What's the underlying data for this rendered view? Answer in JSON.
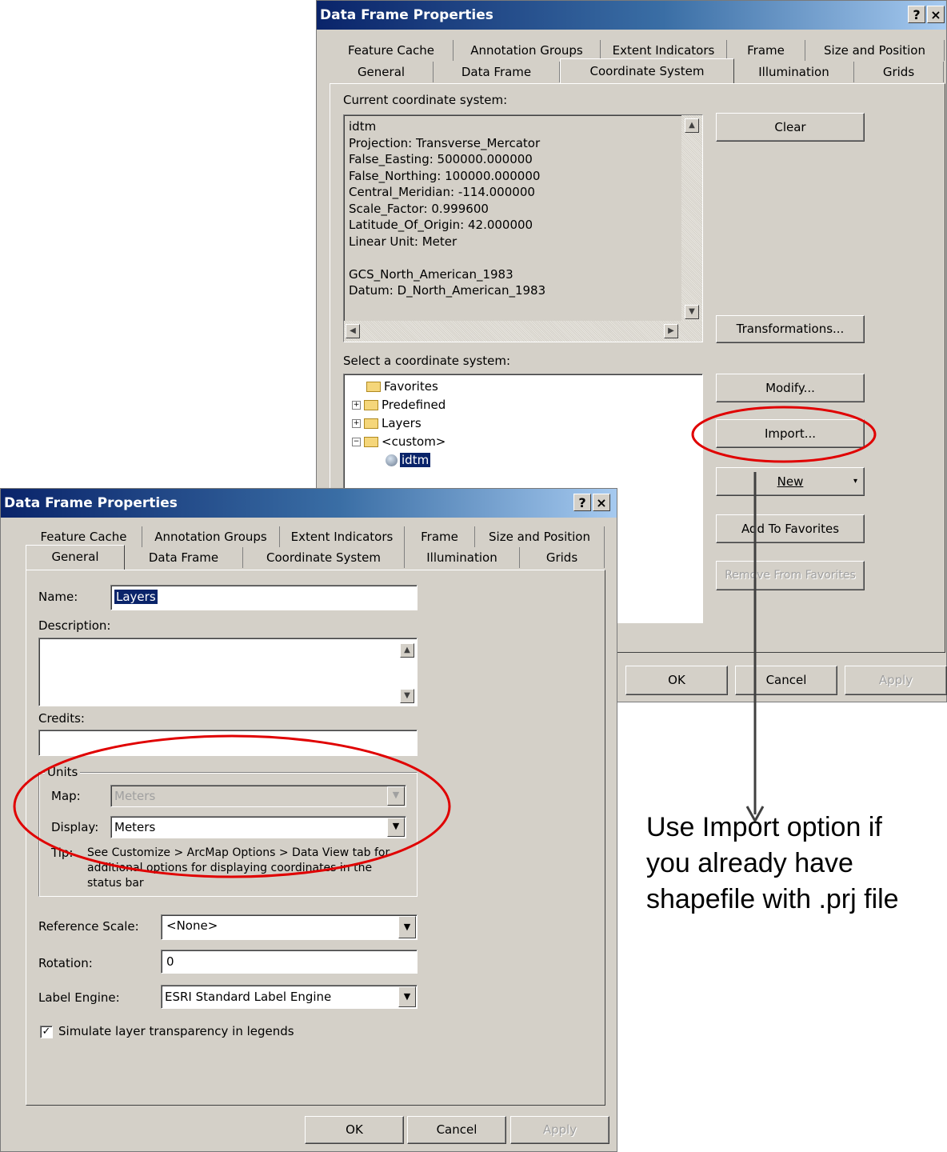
{
  "back_dialog": {
    "title": "Data Frame Properties",
    "help_button": "?",
    "close_button": "×",
    "tabs_row1": [
      "Feature Cache",
      "Annotation Groups",
      "Extent Indicators",
      "Frame",
      "Size and Position"
    ],
    "tabs_row2": [
      "General",
      "Data Frame",
      "Coordinate System",
      "Illumination",
      "Grids"
    ],
    "active_tab": "Coordinate System",
    "current_cs_label": "Current coordinate system:",
    "current_cs_lines": [
      "idtm",
      "Projection: Transverse_Mercator",
      "False_Easting: 500000.000000",
      "False_Northing: 100000.000000",
      "Central_Meridian: -114.000000",
      "Scale_Factor: 0.999600",
      "Latitude_Of_Origin: 42.000000",
      "Linear Unit: Meter",
      "",
      "GCS_North_American_1983",
      "Datum: D_North_American_1983"
    ],
    "select_cs_label": "Select a coordinate system:",
    "tree": {
      "favorites": "Favorites",
      "predefined": "Predefined",
      "layers": "Layers",
      "custom": "<custom>",
      "selected_item": "idtm"
    },
    "buttons": {
      "clear": "Clear",
      "transformations": "Transformations...",
      "modify": "Modify...",
      "import": "Import...",
      "new": "New",
      "add_to_favorites": "Add To Favorites",
      "remove_from_favorites": "Remove From Favorites",
      "ok": "OK",
      "cancel": "Cancel",
      "apply": "Apply"
    }
  },
  "front_dialog": {
    "title": "Data Frame Properties",
    "help_button": "?",
    "close_button": "×",
    "tabs_row1": [
      "Feature Cache",
      "Annotation Groups",
      "Extent Indicators",
      "Frame",
      "Size and Position"
    ],
    "tabs_row2": [
      "General",
      "Data Frame",
      "Coordinate System",
      "Illumination",
      "Grids"
    ],
    "active_tab": "General",
    "name_label": "Name:",
    "name_value": "Layers",
    "description_label": "Description:",
    "credits_label": "Credits:",
    "units_label": "Units",
    "map_label": "Map:",
    "map_value": "Meters",
    "display_label": "Display:",
    "display_value": "Meters",
    "tip_label": "Tip:",
    "tip_text": "See Customize > ArcMap Options > Data View tab for additional options for displaying coordinates in the status bar",
    "reference_scale_label": "Reference Scale:",
    "reference_scale_value": "<None>",
    "rotation_label": "Rotation:",
    "rotation_value": "0",
    "label_engine_label": "Label Engine:",
    "label_engine_value": "ESRI Standard Label Engine",
    "simulate_checkbox_label": "Simulate layer transparency in legends",
    "simulate_checked": true,
    "buttons": {
      "ok": "OK",
      "cancel": "Cancel",
      "apply": "Apply"
    }
  },
  "annotation": {
    "text": "Use Import option if you already have shapefile with .prj file",
    "highlight_color": "#e00000",
    "arrow_color": "#404040"
  }
}
